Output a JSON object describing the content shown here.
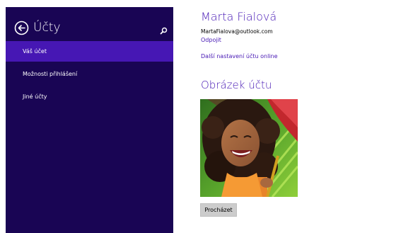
{
  "sidebar": {
    "title": "Účty",
    "items": [
      {
        "label": "Váš účet",
        "active": true
      },
      {
        "label": "Možnosti přihlášení",
        "active": false
      },
      {
        "label": "Jiné účty",
        "active": false
      }
    ]
  },
  "account": {
    "name": "Marta Fialová",
    "email": "MartaFialova@outlook.com",
    "disconnect_link": "Odpojit",
    "more_settings_link": "Další nastavení účtu online"
  },
  "picture_section": {
    "title": "Obrázek účtu",
    "browse_label": "Procházet"
  },
  "colors": {
    "sidebar_bg": "#190554",
    "selected_item_bg": "#4617b4",
    "accent": "#4617b4"
  },
  "icons": {
    "back": "back-arrow-circle-icon",
    "search": "magnifier-icon"
  }
}
